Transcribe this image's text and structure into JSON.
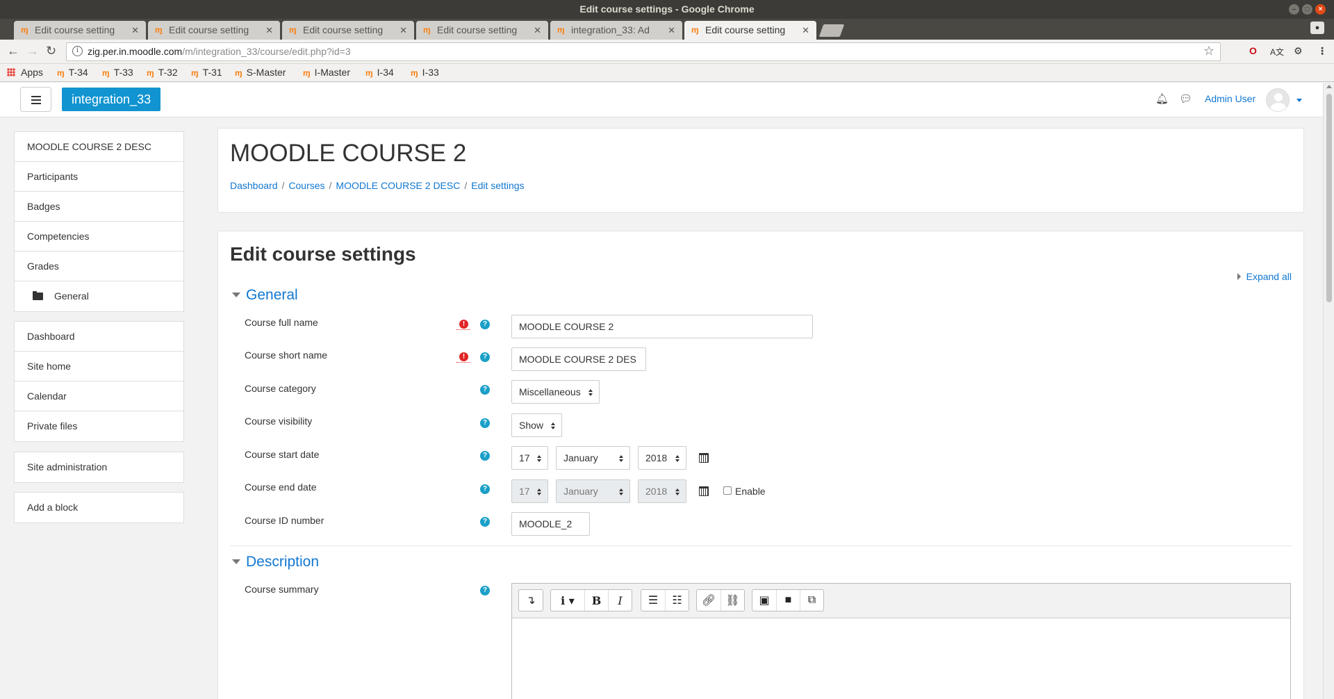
{
  "window": {
    "title": "Edit course settings - Google Chrome"
  },
  "tabs": [
    {
      "label": "Edit course setting"
    },
    {
      "label": "Edit course setting"
    },
    {
      "label": "Edit course setting"
    },
    {
      "label": "Edit course setting"
    },
    {
      "label": "integration_33: Ad"
    },
    {
      "label": "Edit course setting"
    }
  ],
  "address": {
    "host": "zig.per.in.moodle.com",
    "path": "/m/integration_33/course/edit.php?id=3"
  },
  "bookmarks": [
    "Apps",
    "T-34",
    "T-33",
    "T-32",
    "T-31",
    "S-Master",
    "I-Master",
    "I-34",
    "I-33"
  ],
  "navbar": {
    "brand": "integration_33",
    "user": "Admin User"
  },
  "course_nav": {
    "items": [
      "MOODLE COURSE 2 DESC",
      "Participants",
      "Badges",
      "Competencies",
      "Grades",
      "General"
    ]
  },
  "site_nav": {
    "items": [
      "Dashboard",
      "Site home",
      "Calendar",
      "Private files"
    ]
  },
  "admin_block": {
    "label": "Site administration"
  },
  "add_block": {
    "label": "Add a block"
  },
  "page": {
    "title": "MOODLE COURSE 2",
    "breadcrumb": [
      "Dashboard",
      "Courses",
      "MOODLE COURSE 2 DESC",
      "Edit settings"
    ]
  },
  "form": {
    "title": "Edit course settings",
    "expand_all": "Expand all",
    "sections": {
      "general": "General",
      "description": "Description"
    },
    "fields": {
      "fullname": {
        "label": "Course full name",
        "value": "MOODLE COURSE 2"
      },
      "shortname": {
        "label": "Course short name",
        "value": "MOODLE COURSE 2 DES"
      },
      "category": {
        "label": "Course category",
        "value": "Miscellaneous"
      },
      "visibility": {
        "label": "Course visibility",
        "value": "Show"
      },
      "startdate": {
        "label": "Course start date",
        "day": "17",
        "month": "January",
        "year": "2018"
      },
      "enddate": {
        "label": "Course end date",
        "day": "17",
        "month": "January",
        "year": "2018",
        "enable_label": "Enable",
        "enabled": false
      },
      "idnumber": {
        "label": "Course ID number",
        "value": "MOODLE_2"
      },
      "summary": {
        "label": "Course summary"
      }
    }
  },
  "colors": {
    "brand": "#1194d0",
    "link": "#1177d1",
    "required": "#e02525",
    "help": "#1aa0c8"
  }
}
